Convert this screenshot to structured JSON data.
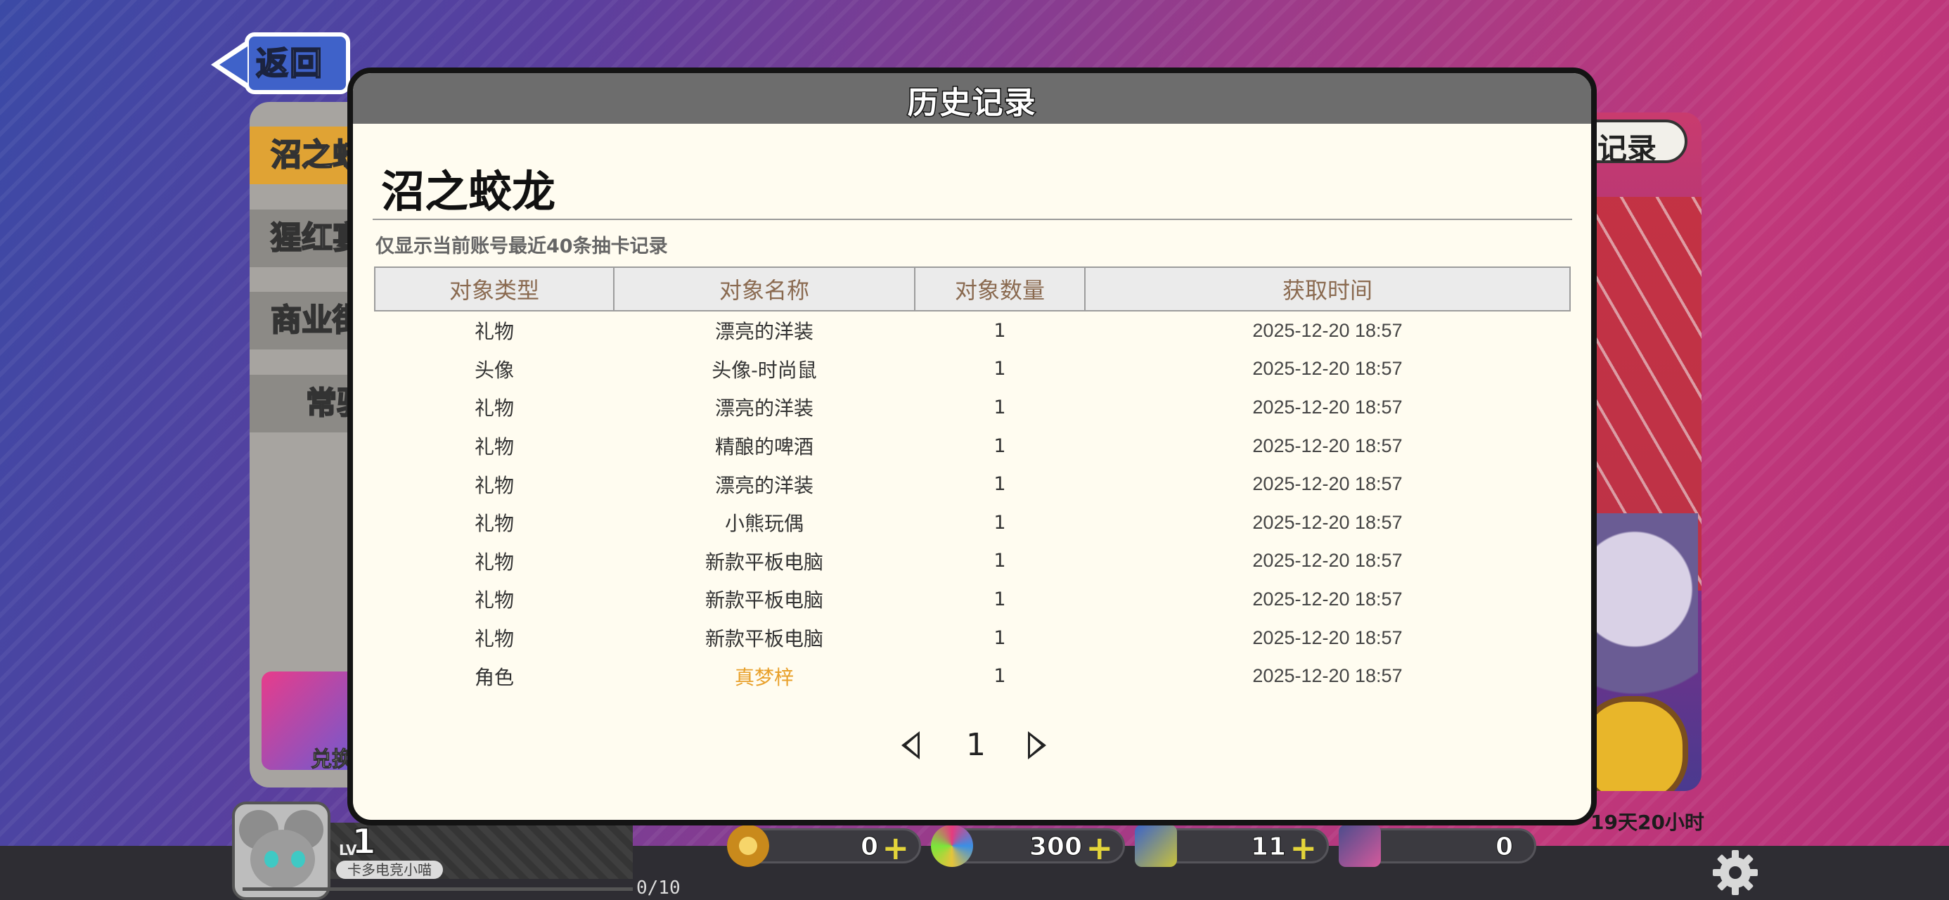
{
  "back_label": "返回",
  "left_tabs": [
    "沼之蛟龙",
    "猩红宴",
    "商业街",
    "常驻"
  ],
  "exchange_label": "兑换",
  "right_record_tab": "记录",
  "timer": "19天20小时",
  "modal": {
    "title": "历史记录",
    "pool_name": "沼之蛟龙",
    "note": "仅显示当前账号最近40条抽卡记录",
    "columns": [
      "对象类型",
      "对象名称",
      "对象数量",
      "获取时间"
    ],
    "rows": [
      {
        "type": "礼物",
        "name": "漂亮的洋装",
        "count": "1",
        "time": "2025-12-20 18:57"
      },
      {
        "type": "头像",
        "name": "头像-时尚鼠",
        "count": "1",
        "time": "2025-12-20 18:57"
      },
      {
        "type": "礼物",
        "name": "漂亮的洋装",
        "count": "1",
        "time": "2025-12-20 18:57"
      },
      {
        "type": "礼物",
        "name": "精酿的啤酒",
        "count": "1",
        "time": "2025-12-20 18:57"
      },
      {
        "type": "礼物",
        "name": "漂亮的洋装",
        "count": "1",
        "time": "2025-12-20 18:57"
      },
      {
        "type": "礼物",
        "name": "小熊玩偶",
        "count": "1",
        "time": "2025-12-20 18:57"
      },
      {
        "type": "礼物",
        "name": "新款平板电脑",
        "count": "1",
        "time": "2025-12-20 18:57"
      },
      {
        "type": "礼物",
        "name": "新款平板电脑",
        "count": "1",
        "time": "2025-12-20 18:57"
      },
      {
        "type": "礼物",
        "name": "新款平板电脑",
        "count": "1",
        "time": "2025-12-20 18:57"
      },
      {
        "type": "角色",
        "name": "真梦梓",
        "count": "1",
        "time": "2025-12-20 18:57",
        "highlight": "#e8a02a"
      }
    ],
    "page": "1"
  },
  "player": {
    "level_label": "LV",
    "level": "1",
    "name": "卡多电竞小喵",
    "exp": "0/10"
  },
  "currencies": [
    {
      "value": "0",
      "plus": "+"
    },
    {
      "value": "300",
      "plus": "+"
    },
    {
      "value": "11",
      "plus": "+"
    },
    {
      "value": "0"
    }
  ],
  "icons": {
    "back": "left-arrow-icon",
    "settings": "gear-icon",
    "prev": "triangle-left-icon",
    "next": "triangle-right-icon"
  }
}
